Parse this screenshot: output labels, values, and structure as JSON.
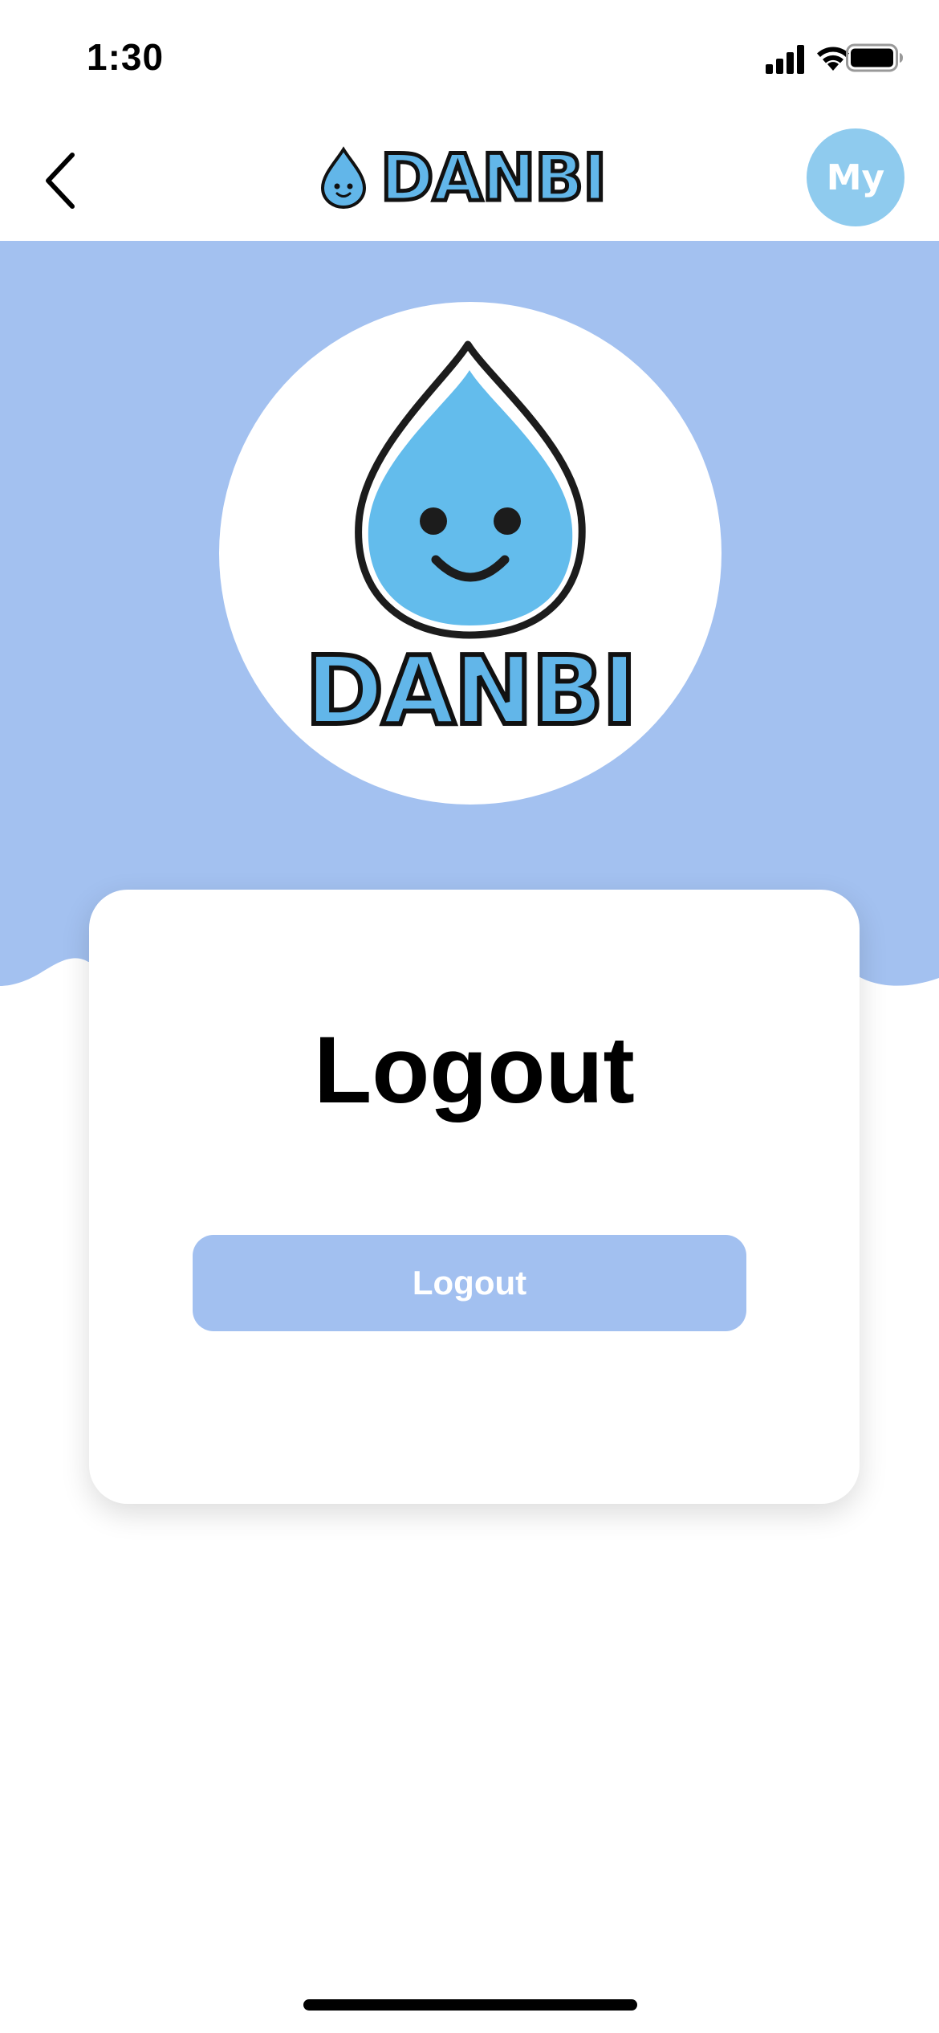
{
  "status_bar": {
    "time": "1:30",
    "icons": [
      "cellular-signal-icon",
      "wifi-icon",
      "battery-icon"
    ]
  },
  "header": {
    "back_icon": "chevron-left-icon",
    "logo_text": "DANBI",
    "my_button_label": "My"
  },
  "hero": {
    "logo_text": "DANBI"
  },
  "card": {
    "title": "Logout",
    "button_label": "Logout"
  },
  "colors": {
    "hero_background": "#a3c1f0",
    "button_background": "#a2c0f0",
    "my_button_background": "#8fcbee",
    "logo_blue": "#62b6e9"
  }
}
